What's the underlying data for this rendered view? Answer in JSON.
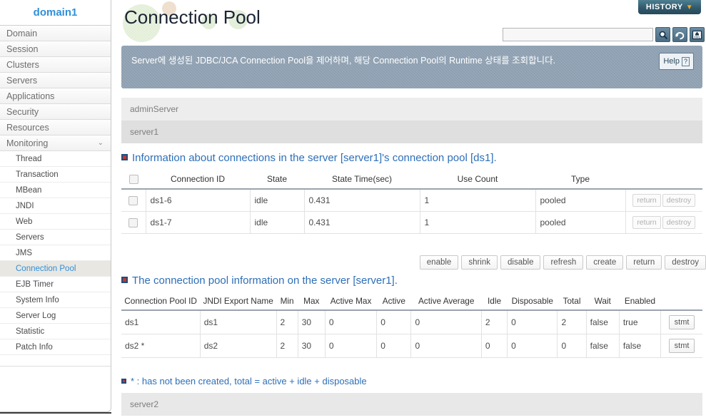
{
  "sidebar": {
    "domain_label": "domain1",
    "top_items": [
      {
        "label": "Domain",
        "expandable": false
      },
      {
        "label": "Session",
        "expandable": false
      },
      {
        "label": "Clusters",
        "expandable": false
      },
      {
        "label": "Servers",
        "expandable": false
      },
      {
        "label": "Applications",
        "expandable": false
      },
      {
        "label": "Security",
        "expandable": false
      },
      {
        "label": "Resources",
        "expandable": false
      },
      {
        "label": "Monitoring",
        "expandable": true,
        "chevron": "⌄"
      }
    ],
    "sub_items": [
      {
        "label": "Thread",
        "active": false
      },
      {
        "label": "Transaction",
        "active": false
      },
      {
        "label": "MBean",
        "active": false
      },
      {
        "label": "JNDI",
        "active": false
      },
      {
        "label": "Web",
        "active": false
      },
      {
        "label": "Servers",
        "active": false
      },
      {
        "label": "JMS",
        "active": false
      },
      {
        "label": "Connection Pool",
        "active": true
      },
      {
        "label": "EJB Timer",
        "active": false
      },
      {
        "label": "System Info",
        "active": false
      },
      {
        "label": "Server Log",
        "active": false
      },
      {
        "label": "Statistic",
        "active": false
      },
      {
        "label": "Patch Info",
        "active": false
      }
    ],
    "accent_color": "#2f8fd8",
    "active_bg": "#e9e7e2"
  },
  "header": {
    "title": "Connection Pool",
    "history_label": "HISTORY",
    "history_caret": "▼",
    "history_caret_color": "#f0a81e",
    "search_value": "",
    "search_placeholder": "",
    "tools": [
      {
        "name": "search-icon",
        "title": "search"
      },
      {
        "name": "refresh-icon",
        "title": "refresh"
      },
      {
        "name": "xml-export-icon",
        "title": "xml"
      }
    ]
  },
  "description": {
    "text": "Server에 생성된 JDBC/JCA Connection Pool을 제어하며, 해당 Connection Pool의 Runtime 상태를 조회합니다.",
    "help_label": "Help",
    "help_mark": "?",
    "bg_color": "#8c9eb0"
  },
  "servers": {
    "admin": "adminServer",
    "server1": "server1",
    "server2": "server2"
  },
  "section1": {
    "title": "Information about connections in the server [server1]'s connection pool [ds1].",
    "columns": [
      "",
      "Connection ID",
      "State",
      "State Time(sec)",
      "Use Count",
      "Type",
      ""
    ],
    "rows": [
      {
        "connection_id": "ds1-6",
        "state": "idle",
        "state_time": "0.431",
        "use_count": "1",
        "type": "pooled",
        "return_label": "return",
        "destroy_label": "destroy"
      },
      {
        "connection_id": "ds1-7",
        "state": "idle",
        "state_time": "0.431",
        "use_count": "1",
        "type": "pooled",
        "return_label": "return",
        "destroy_label": "destroy"
      }
    ]
  },
  "actions": [
    {
      "label": "enable"
    },
    {
      "label": "shrink"
    },
    {
      "label": "disable"
    },
    {
      "label": "refresh"
    },
    {
      "label": "create"
    },
    {
      "label": "return"
    },
    {
      "label": "destroy"
    }
  ],
  "section2": {
    "title": "The connection pool information on the server [server1].",
    "columns": [
      "Connection Pool ID",
      "JNDI Export Name",
      "Min",
      "Max",
      "Active Max",
      "Active",
      "Active Average",
      "Idle",
      "Disposable",
      "Total",
      "Wait",
      "Enabled",
      ""
    ],
    "rows": [
      {
        "pool_id": "ds1",
        "jndi": "ds1",
        "min": "2",
        "max": "30",
        "active_max": "0",
        "active": "0",
        "active_avg": "0",
        "idle": "2",
        "disposable": "0",
        "total": "2",
        "wait": "false",
        "enabled": "true",
        "stmt_label": "stmt"
      },
      {
        "pool_id": "ds2 *",
        "jndi": "ds2",
        "min": "2",
        "max": "30",
        "active_max": "0",
        "active": "0",
        "active_avg": "0",
        "idle": "0",
        "disposable": "0",
        "total": "0",
        "wait": "false",
        "enabled": "false",
        "stmt_label": "stmt"
      }
    ]
  },
  "footnote": {
    "text": "* : has not been created, total = active + idle + disposable",
    "color": "#2d6fb8"
  }
}
